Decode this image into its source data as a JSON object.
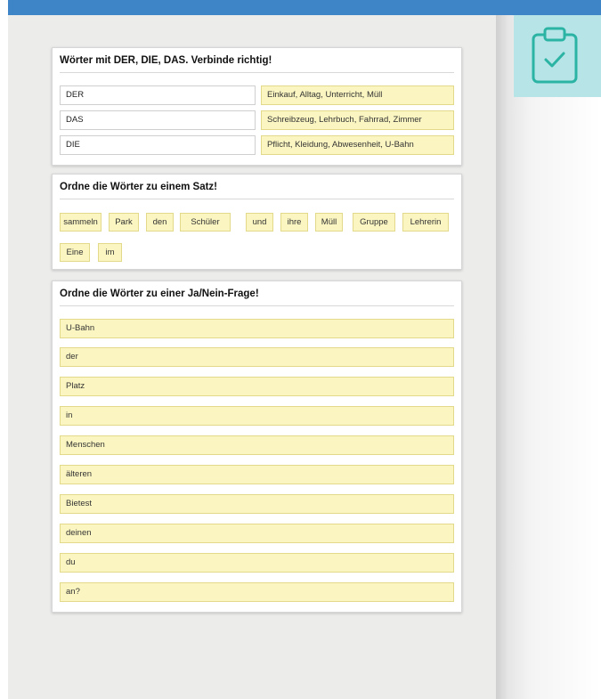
{
  "colors": {
    "accent": "#3d85c6",
    "answer_bg": "#fbf6c1",
    "clipboard_bg": "#b7e4e7",
    "clipboard_icon": "#2bb3a3"
  },
  "exercise1": {
    "title": "Wörter mit DER, DIE, DAS. Verbinde richtig!",
    "rows": [
      {
        "article": "DER",
        "words": "Einkauf, Alltag, Unterricht, Müll"
      },
      {
        "article": "DAS",
        "words": "Schreibzeug, Lehrbuch, Fahrrad, Zimmer"
      },
      {
        "article": "DIE",
        "words": "Pflicht, Kleidung, Abwesenheit, U-Bahn"
      }
    ]
  },
  "exercise2": {
    "title": "Ordne die Wörter zu einem Satz!",
    "words": [
      "sammeln",
      "Park",
      "den",
      "Schüler",
      "und",
      "ihre",
      "Müll",
      "Gruppe",
      "Lehrerin",
      "Eine",
      "im"
    ]
  },
  "exercise3": {
    "title": "Ordne die Wörter zu einer Ja/Nein-Frage!",
    "words": [
      "U-Bahn",
      "der",
      "Platz",
      "in",
      "Menschen",
      "älteren",
      "Bietest",
      "deinen",
      "du",
      "an?"
    ]
  },
  "icons": {
    "clipboard": "clipboard-check-icon"
  }
}
